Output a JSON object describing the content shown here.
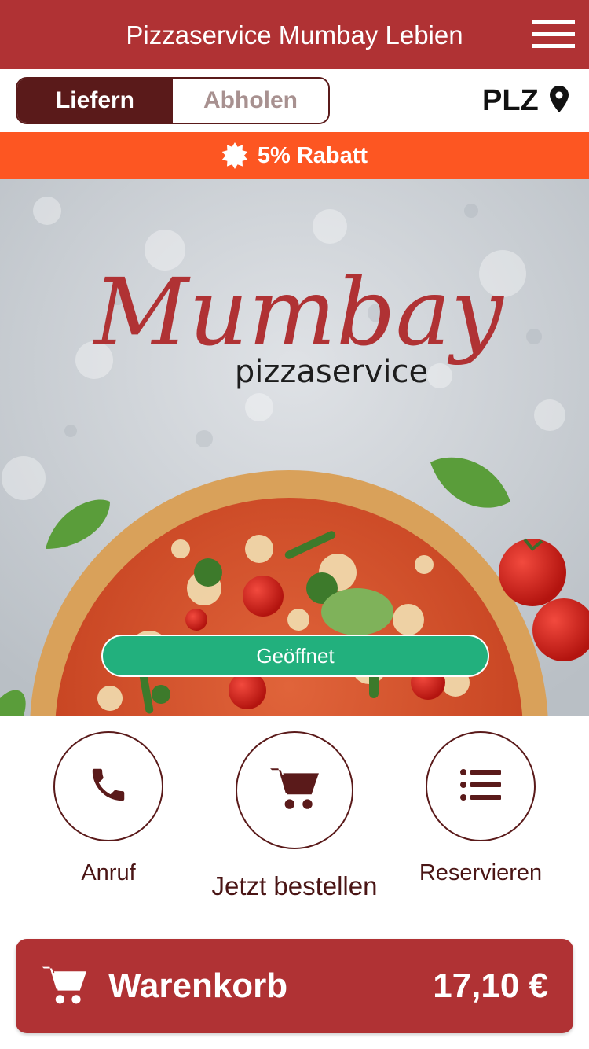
{
  "header": {
    "title": "Pizzaservice Mumbay Lebien",
    "menu_icon": "hamburger-menu-icon"
  },
  "order_mode": {
    "options": [
      "Liefern",
      "Abholen"
    ],
    "selected": "Liefern"
  },
  "postcode": {
    "label": "PLZ",
    "icon": "location-pin-icon"
  },
  "promo": {
    "text": "5% Rabatt",
    "icon": "discount-badge-icon"
  },
  "hero": {
    "logo_script": "Mumbay",
    "logo_subtitle": "pizzaservice",
    "status": "Geöffnet"
  },
  "actions": [
    {
      "label": "Anruf",
      "icon": "phone-icon"
    },
    {
      "label": "Jetzt bestellen",
      "icon": "cart-icon"
    },
    {
      "label": "Reservieren",
      "icon": "list-icon"
    }
  ],
  "cart": {
    "label": "Warenkorb",
    "total": "17,10 €",
    "icon": "cart-icon"
  },
  "colors": {
    "brand_red": "#b03234",
    "dark_maroon": "#5a1a1a",
    "promo_orange": "#fd5622",
    "open_green": "#22b07d"
  }
}
